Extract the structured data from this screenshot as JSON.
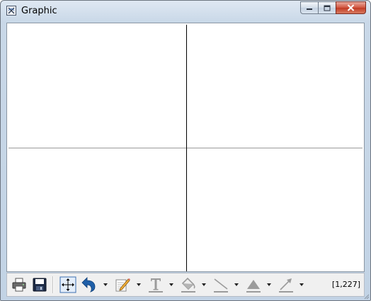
{
  "window": {
    "title": "Graphic",
    "app_icon": "graphic-window-icon",
    "controls": {
      "minimize": "minimize-icon",
      "maximize": "maximize-icon",
      "close": "close-icon"
    }
  },
  "toolbar": {
    "tools": [
      {
        "name": "print-icon",
        "enabled": true
      },
      {
        "name": "save-icon",
        "enabled": true
      },
      {
        "name": "fit-view-icon",
        "enabled": true
      },
      {
        "name": "undo-icon",
        "enabled": true,
        "dropdown": true
      },
      {
        "name": "edit-pencil-icon",
        "enabled": true,
        "dropdown": true
      },
      {
        "name": "text-tool-icon",
        "enabled": false,
        "dropdown": true
      },
      {
        "name": "fill-bucket-icon",
        "enabled": false,
        "dropdown": true
      },
      {
        "name": "line-tool-icon",
        "enabled": false,
        "dropdown": true
      },
      {
        "name": "marker-triangle-icon",
        "enabled": false,
        "dropdown": true
      },
      {
        "name": "arrow-tool-icon",
        "enabled": false,
        "dropdown": true
      }
    ],
    "coordinates": "[1,227]"
  },
  "colors": {
    "frame": "#c2d3e5",
    "close_button": "#c13a24",
    "toolbar_icon_blue": "#1f5fa8",
    "disabled_icon": "#9b9b9b"
  }
}
